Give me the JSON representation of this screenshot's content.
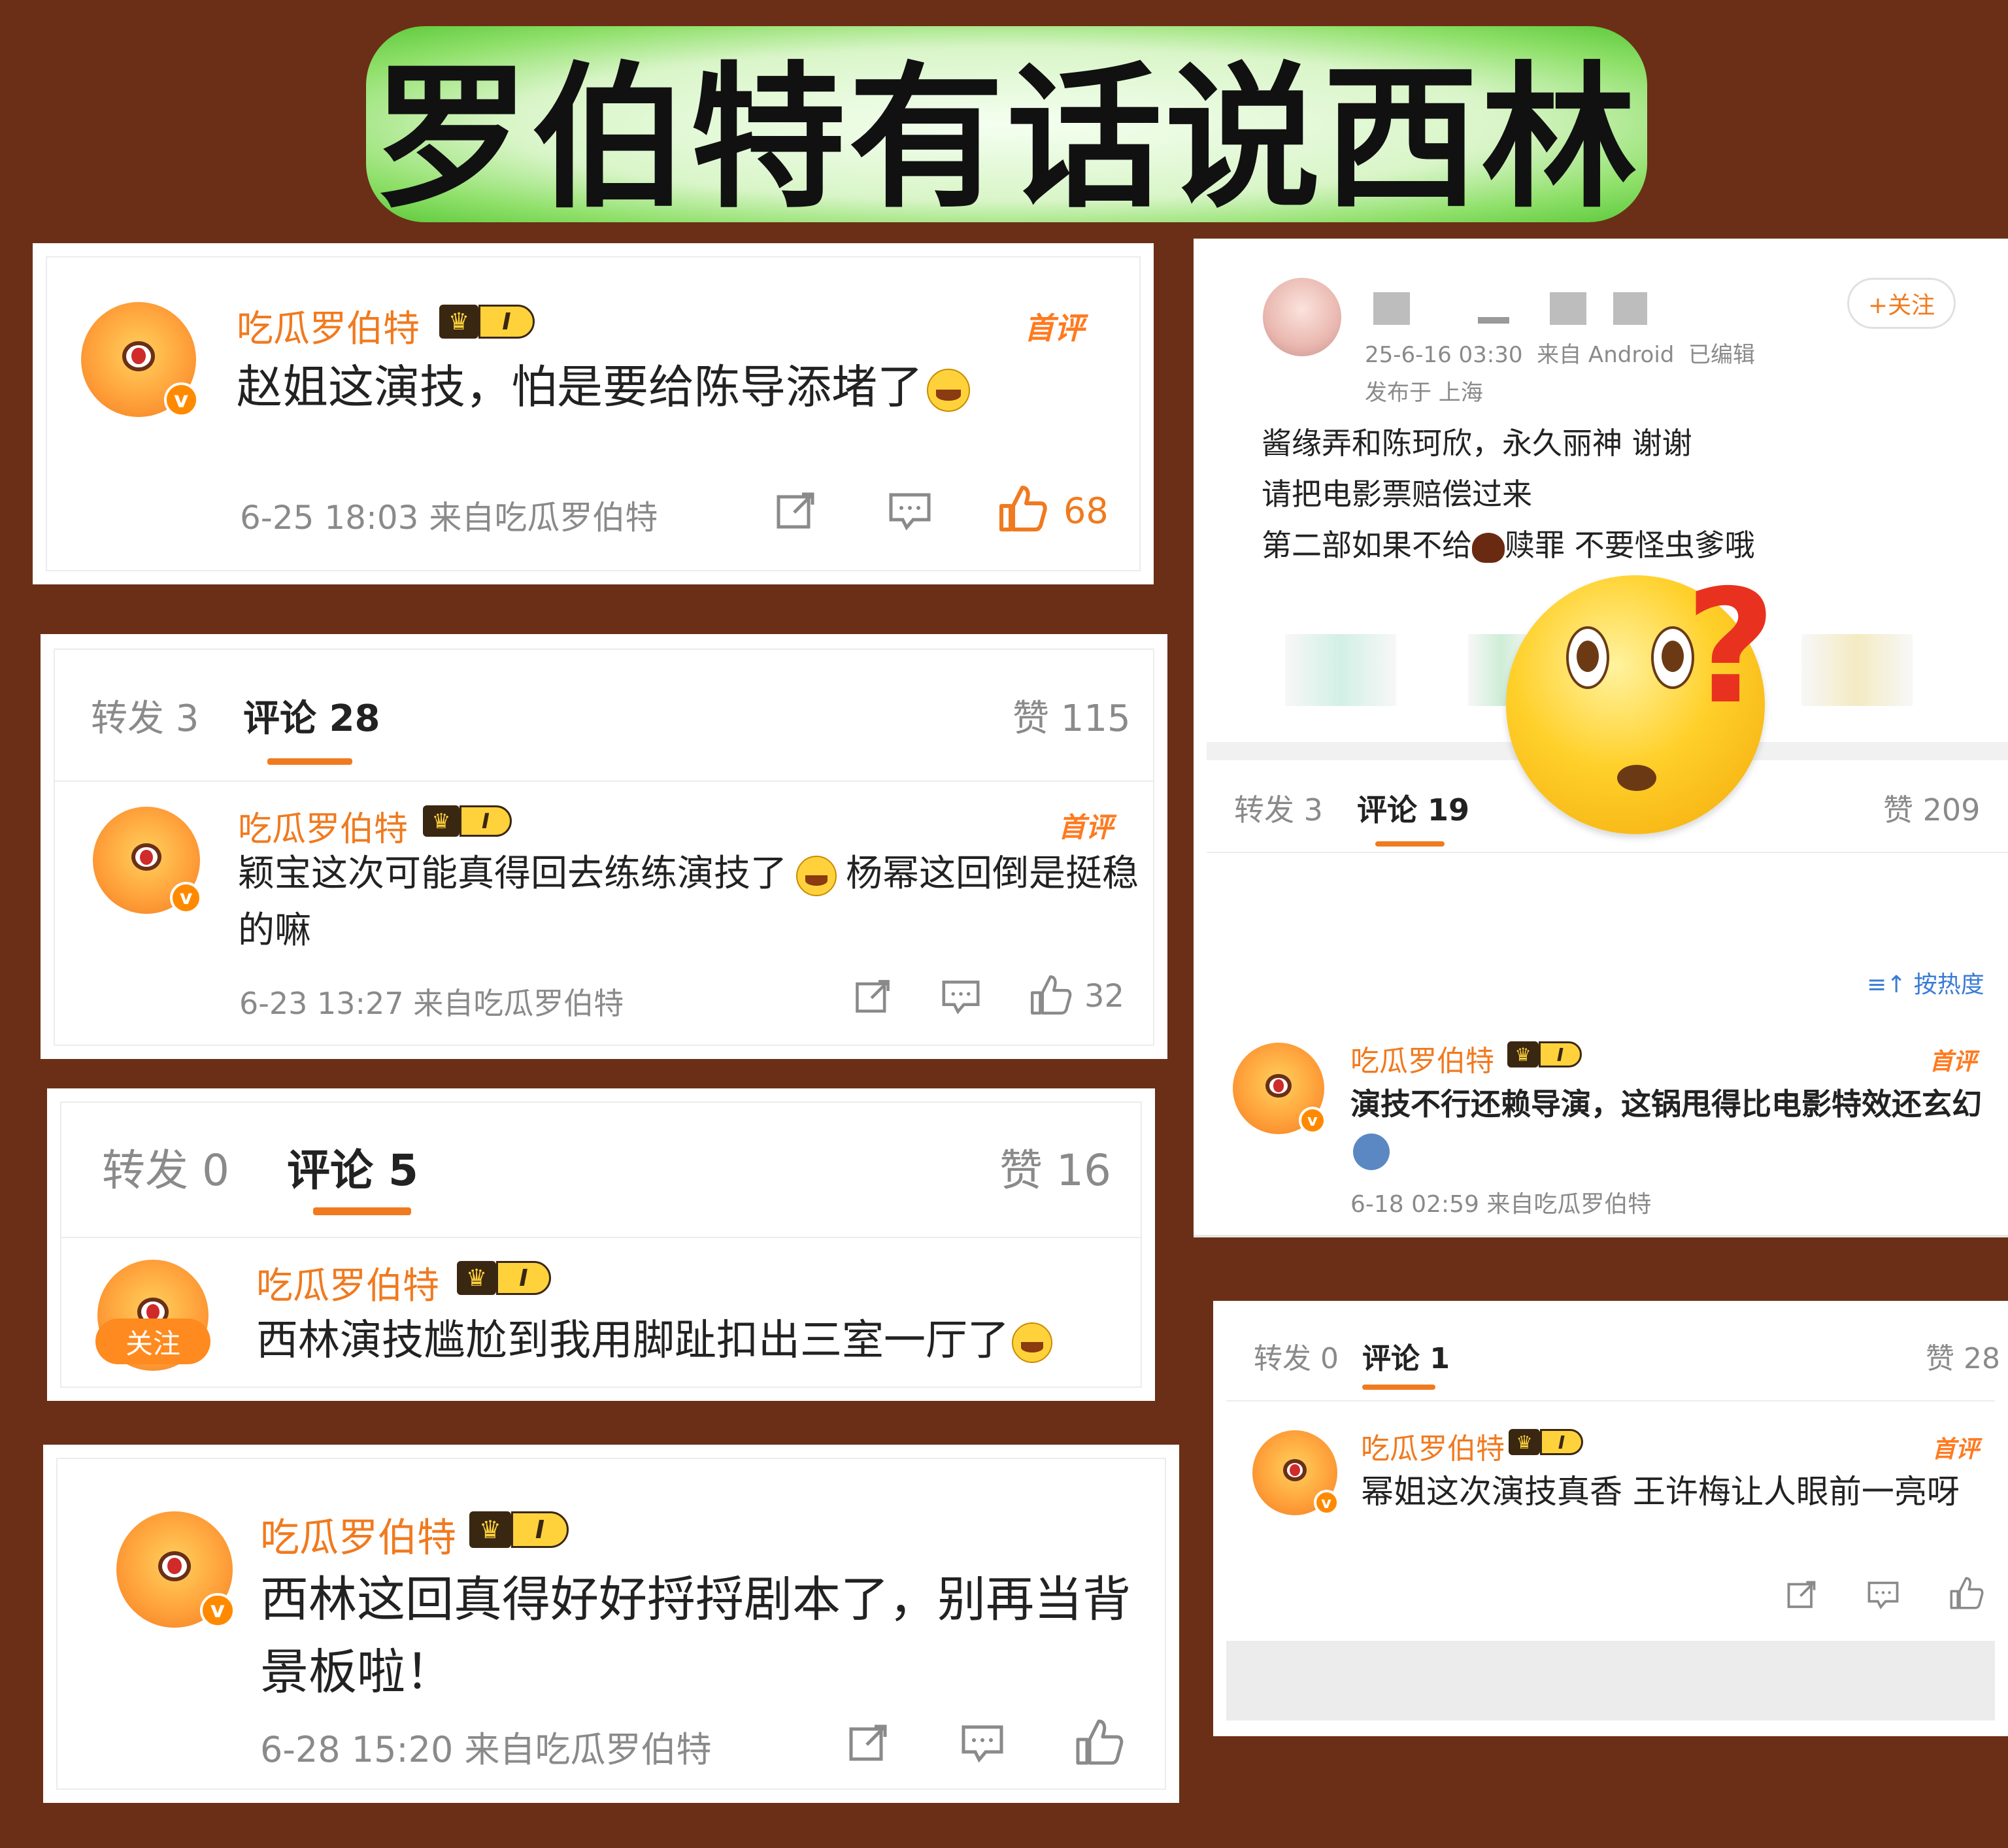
{
  "title": "罗伯特有话说西林",
  "username": "吃瓜罗伯特",
  "level": "I",
  "first_comment_badge": "首评",
  "icons": {
    "share": "share-icon",
    "comment": "comment-icon",
    "like": "thumbs-up-icon",
    "crown": "crown-icon",
    "laugh": "laugh-cry-emoji",
    "sort": "sort-icon",
    "confused": "confused-emoji"
  },
  "colors": {
    "background": "#6b2f17",
    "accent": "#f07a1f",
    "title_glow": "#5cc93a"
  },
  "card1": {
    "text": "赵姐这演技，怕是要给陈导添堵了",
    "meta": "6-25 18:03 来自吃瓜罗伯特",
    "likes": "68"
  },
  "card2": {
    "tabs": {
      "repost": "转发 3",
      "comment": "评论 28",
      "like": "赞 115"
    },
    "text_a": "颖宝这次可能真得回去练练演技了",
    "text_b": "杨幂这回倒是挺稳的嘛",
    "meta": "6-23 13:27 来自吃瓜罗伯特",
    "likes": "32"
  },
  "card3": {
    "tabs": {
      "repost": "转发 0",
      "comment": "评论 5",
      "like": "赞 16"
    },
    "follow": "关注",
    "text": "西林演技尴尬到我用脚趾扣出三室一厅了"
  },
  "card4": {
    "text": "西林这回真得好好捋捋剧本了，别再当背景板啦！",
    "meta": "6-28 15:20 来自吃瓜罗伯特"
  },
  "post": {
    "follow": "+关注",
    "meta_time": "25-6-16 03:30",
    "meta_source": "来自 Android",
    "meta_edited": "已编辑",
    "location": "发布于 上海",
    "line1": "酱缘弄和陈珂欣，永久丽神 谢谢",
    "line2": "请把电影票赔偿过来",
    "line3a": "第二部如果不给",
    "line3b": "赎罪 不要怪虫爹哦",
    "tabs": {
      "repost": "转发 3",
      "comment": "评论 19",
      "like": "赞 209"
    },
    "sort": "按热度",
    "comment_text": "演技不行还赖导演，这锅甩得比电影特效还玄幻",
    "comment_meta": "6-18 02:59 来自吃瓜罗伯特"
  },
  "card6": {
    "tabs": {
      "repost": "转发 0",
      "comment": "评论 1",
      "like": "赞 28"
    },
    "text": "幂姐这次演技真香 王许梅让人眼前一亮呀"
  }
}
